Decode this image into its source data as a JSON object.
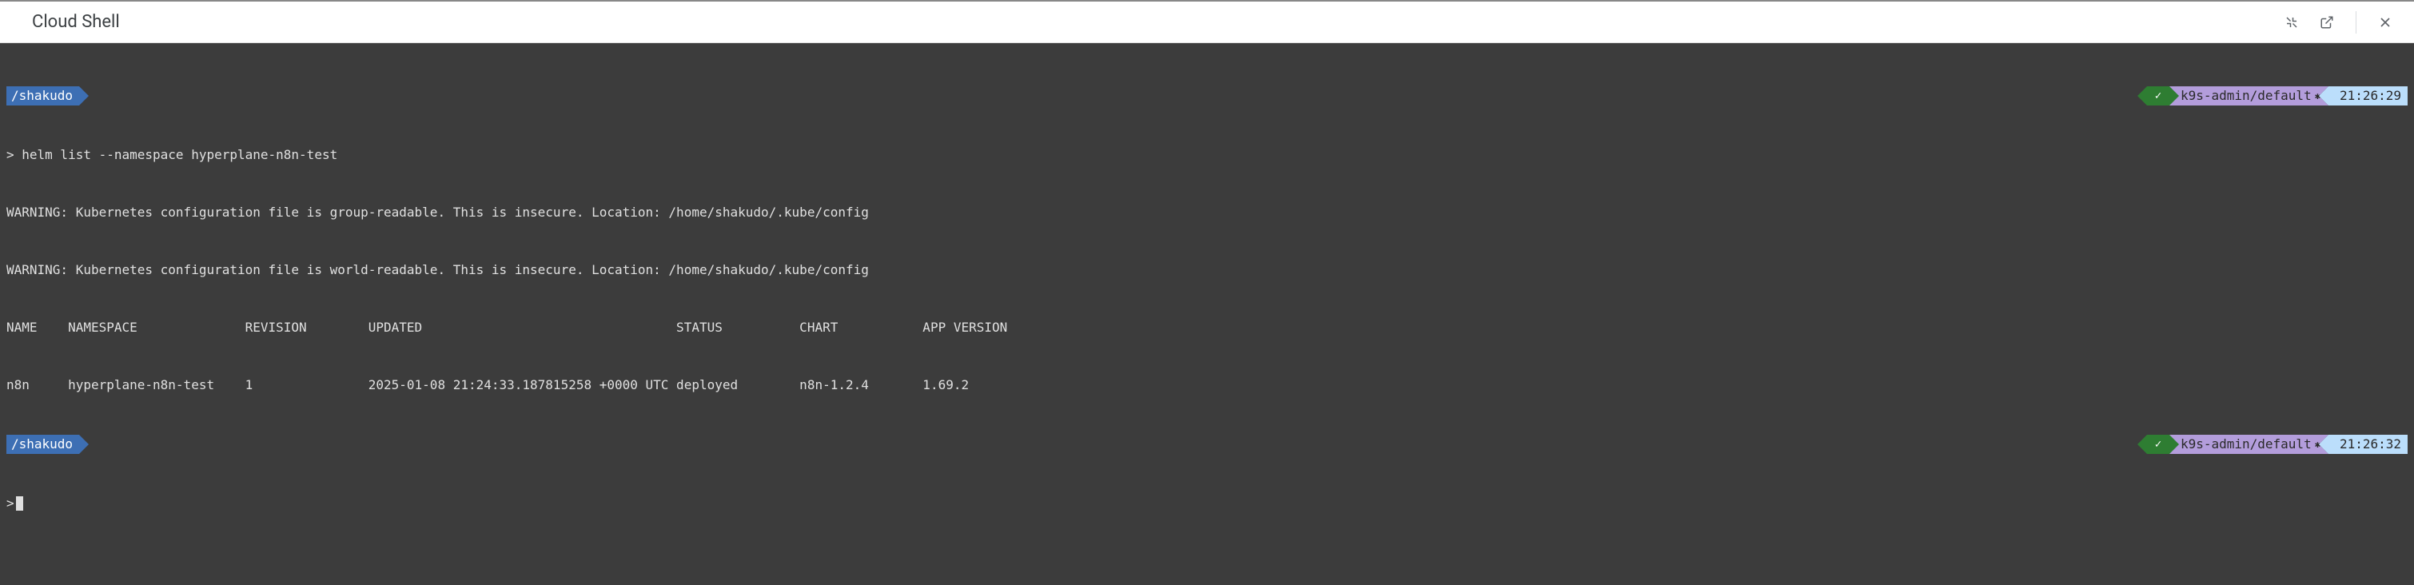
{
  "header": {
    "title": "Cloud Shell"
  },
  "terminal": {
    "prompt1": {
      "path": "/shakudo",
      "context": "k9s-admin/default",
      "time": "21:26:29",
      "check": "✓",
      "gear": "✱"
    },
    "command1": "> helm list --namespace hyperplane-n8n-test",
    "warn1": "WARNING: Kubernetes configuration file is group-readable. This is insecure. Location: /home/shakudo/.kube/config",
    "warn2": "WARNING: Kubernetes configuration file is world-readable. This is insecure. Location: /home/shakudo/.kube/config",
    "table_header": "NAME    NAMESPACE              REVISION        UPDATED                                 STATUS          CHART           APP VERSION",
    "table_row": "n8n     hyperplane-n8n-test    1               2025-01-08 21:24:33.187815258 +0000 UTC deployed        n8n-1.2.4       1.69.2     ",
    "prompt2": {
      "path": "/shakudo",
      "context": "k9s-admin/default",
      "time": "21:26:32",
      "check": "✓",
      "gear": "✱"
    },
    "command2_prefix": ">"
  }
}
